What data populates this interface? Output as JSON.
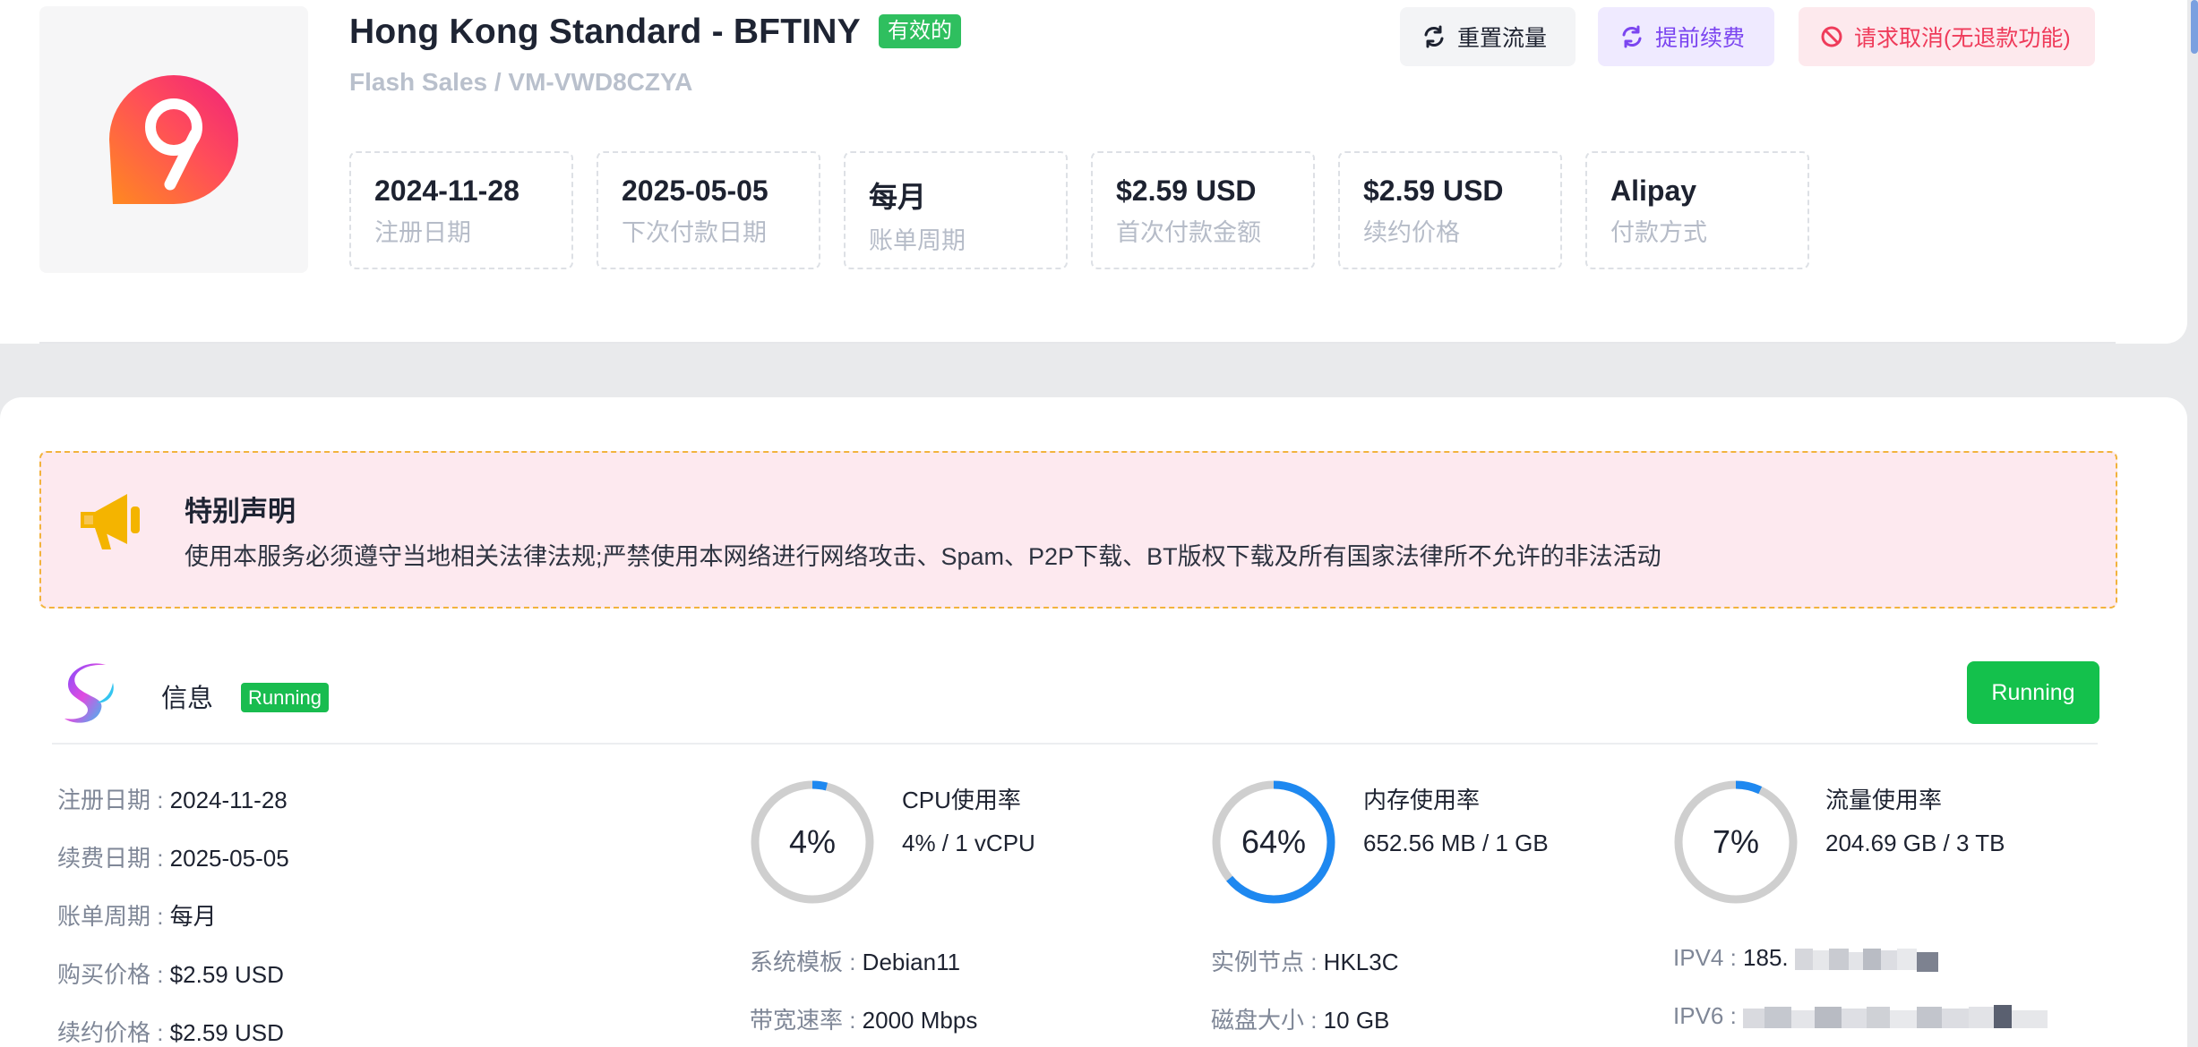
{
  "header": {
    "title": "Hong Kong Standard - BFTINY",
    "status": "有效的",
    "subtitle": "Flash Sales / VM-VWD8CZYA"
  },
  "actions": {
    "reset_traffic": "重置流量",
    "renew_early": "提前续费",
    "request_cancel": "请求取消(无退款功能)"
  },
  "stats": [
    {
      "value": "2024-11-28",
      "label": "注册日期"
    },
    {
      "value": "2025-05-05",
      "label": "下次付款日期"
    },
    {
      "value": "每月",
      "label": "账单周期"
    },
    {
      "value": "$2.59 USD",
      "label": "首次付款金额"
    },
    {
      "value": "$2.59 USD",
      "label": "续约价格"
    },
    {
      "value": "Alipay",
      "label": "付款方式"
    }
  ],
  "notice": {
    "title": "特别声明",
    "text": "使用本服务必须遵守当地相关法律法规;严禁使用本网络进行网络攻击、Spam、P2P下载、BT版权下载及所有国家法律所不允许的非法活动"
  },
  "info": {
    "title": "信息",
    "badge": "Running",
    "running_button": "Running",
    "details": [
      {
        "key": "注册日期 : ",
        "value": "2024-11-28"
      },
      {
        "key": "续费日期 : ",
        "value": "2025-05-05"
      },
      {
        "key": "账单周期 : ",
        "value": "每月"
      },
      {
        "key": "购买价格 : ",
        "value": "$2.59 USD"
      },
      {
        "key": "续约价格 : ",
        "value": "$2.59 USD"
      }
    ],
    "gauges": [
      {
        "percent_text": "4%",
        "percent": 4,
        "label": "CPU使用率",
        "value": "4% / 1 vCPU"
      },
      {
        "percent_text": "64%",
        "percent": 64,
        "label": "内存使用率",
        "value": "652.56 MB / 1 GB"
      },
      {
        "percent_text": "7%",
        "percent": 7,
        "label": "流量使用率",
        "value": "204.69 GB / 3 TB"
      }
    ],
    "specs": [
      {
        "key": "系统模板 : ",
        "value": "Debian11"
      },
      {
        "key": "带宽速率 : ",
        "value": "2000 Mbps"
      },
      {
        "key": "实例节点 : ",
        "value": "HKL3C"
      },
      {
        "key": "磁盘大小 : ",
        "value": "10 GB"
      },
      {
        "key": "IPV4 : ",
        "value": "185."
      },
      {
        "key": "IPV6 : ",
        "value": ""
      }
    ]
  },
  "colors": {
    "status_green": "#2fbf5f",
    "running_green": "#14c14c",
    "gauge_blue": "#1e88f0",
    "gauge_track": "#cfcfcf",
    "renew_purple": "#7b45f0",
    "cancel_red": "#ef3b5a"
  }
}
